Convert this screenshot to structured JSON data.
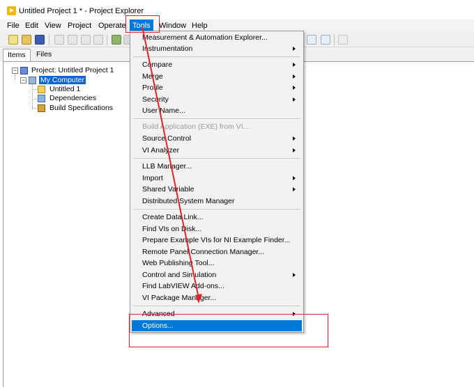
{
  "window": {
    "title": "Untitled Project 1 * - Project Explorer"
  },
  "menubar": {
    "items": [
      "File",
      "Edit",
      "View",
      "Project",
      "Operate",
      "Tools",
      "Window",
      "Help"
    ]
  },
  "tabs": [
    "Items",
    "Files"
  ],
  "tree": {
    "root": "Project: Untitled Project 1",
    "computer": "My Computer",
    "children": [
      "Untitled 1",
      "Dependencies",
      "Build Specifications"
    ]
  },
  "tools_menu": {
    "items": [
      "Measurement & Automation Explorer...",
      "Instrumentation",
      "Compare",
      "Merge",
      "Profile",
      "Security",
      "User Name...",
      "Build Application (EXE) from VI...",
      "Source Control",
      "VI Analyzer",
      "LLB Manager...",
      "Import",
      "Shared Variable",
      "Distributed System Manager",
      "Create Data Link...",
      "Find VIs on Disk...",
      "Prepare Example VIs for NI Example Finder...",
      "Remote Panel Connection Manager...",
      "Web Publishing Tool...",
      "Control and Simulation",
      "Find LabVIEW Add-ons...",
      "VI Package Manager...",
      "Advanced",
      "Options..."
    ]
  },
  "colors": {
    "highlight": "#0078d7",
    "annotation": "#e0242c",
    "selection": "#0a64d3"
  }
}
